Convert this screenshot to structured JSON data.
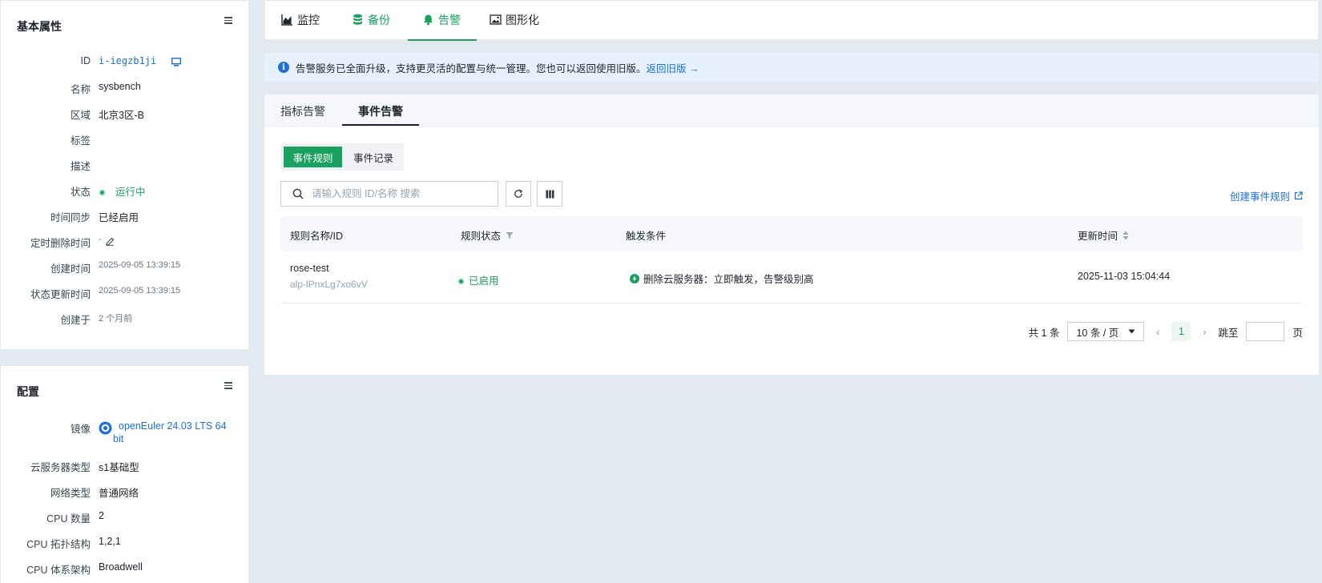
{
  "basic": {
    "title": "基本属性",
    "rows": [
      {
        "key": "ID",
        "value": "i-iegzb1ji"
      },
      {
        "key": "名称",
        "value": "sysbench"
      },
      {
        "key": "区域",
        "value": "北京3区-B"
      },
      {
        "key": "标签",
        "value": ""
      },
      {
        "key": "描述",
        "value": ""
      },
      {
        "key": "状态",
        "value": "运行中"
      },
      {
        "key": "时间同步",
        "value": "已经启用"
      },
      {
        "key": "定时删除时间",
        "value": "-"
      },
      {
        "key": "创建时间",
        "value": "2025-09-05 13:39:15"
      },
      {
        "key": "状态更新时间",
        "value": "2025-09-05 13:39:15"
      },
      {
        "key": "创建于",
        "value": "2 个月前"
      }
    ]
  },
  "config": {
    "title": "配置",
    "rows": [
      {
        "key": "镜像",
        "value": "openEuler 24.03 LTS 64",
        "value2": "bit"
      },
      {
        "key": "云服务器类型",
        "value": "s1基础型"
      },
      {
        "key": "网络类型",
        "value": "普通网络"
      },
      {
        "key": "CPU 数量",
        "value": "2"
      },
      {
        "key": "CPU 拓扑结构",
        "value": "1,2,1"
      },
      {
        "key": "CPU 体系架构",
        "value": "Broadwell"
      }
    ]
  },
  "tabs": [
    {
      "label": "监控",
      "icon": "area-chart-icon"
    },
    {
      "label": "备份",
      "icon": "database-icon"
    },
    {
      "label": "告警",
      "icon": "bell-icon"
    },
    {
      "label": "图形化",
      "icon": "image-icon"
    }
  ],
  "banner": {
    "text": "告警服务已全面升级，支持更灵活的配置与统一管理。您也可以返回使用旧版。",
    "link": "返回旧版 →"
  },
  "subtabs": [
    "指标告警",
    "事件告警"
  ],
  "segments": [
    "事件规则",
    "事件记录"
  ],
  "search": {
    "placeholder": "请输入规则 ID/名称 搜索"
  },
  "create_link": "创建事件规则",
  "table": {
    "headers": [
      "规则名称/ID",
      "规则状态",
      "触发条件",
      "更新时间"
    ],
    "rows": [
      {
        "name": "rose-test",
        "id": "alp-lPnxLg7xo6vV",
        "status": "已启用",
        "condition": "删除云服务器：立即触发，告警级别高",
        "updated": "2025-11-03 15:04:44"
      }
    ]
  },
  "pagination": {
    "total": "共 1 条",
    "page_size": "10 条 / 页",
    "current": "1",
    "jump_label": "跳至",
    "page_unit": "页"
  },
  "colors": {
    "accent": "#1aa05f",
    "link": "#1a6fd8",
    "banner_bg": "#e7f1fd"
  }
}
